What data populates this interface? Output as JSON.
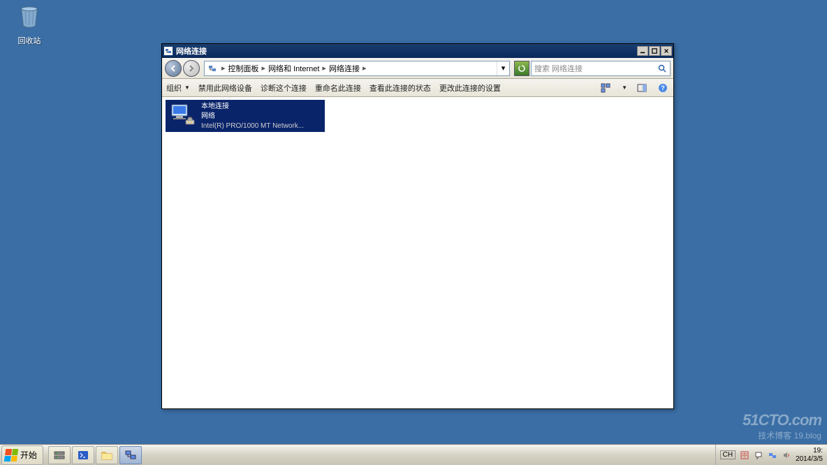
{
  "desktop": {
    "recycle_bin": "回收站"
  },
  "window": {
    "title": "网络连接",
    "breadcrumb": {
      "root_sep": "▸",
      "control_panel": "控制面板",
      "network_internet": "网络和 Internet",
      "network_connections": "网络连接"
    },
    "search_placeholder": "搜索 网络连接",
    "toolbar": {
      "organize": "组织",
      "disable": "禁用此网络设备",
      "diagnose": "诊断这个连接",
      "rename": "重命名此连接",
      "view_status": "查看此连接的状态",
      "change_settings": "更改此连接的设置"
    },
    "connection": {
      "name": "本地连接",
      "status": "网络",
      "device": "Intel(R) PRO/1000 MT Network..."
    }
  },
  "taskbar": {
    "start": "开始",
    "lang": "CH",
    "time": "19:",
    "date": "2014/3/5"
  },
  "watermark": {
    "site": "51CTO.com",
    "sub": "技术博客 19.blog"
  }
}
